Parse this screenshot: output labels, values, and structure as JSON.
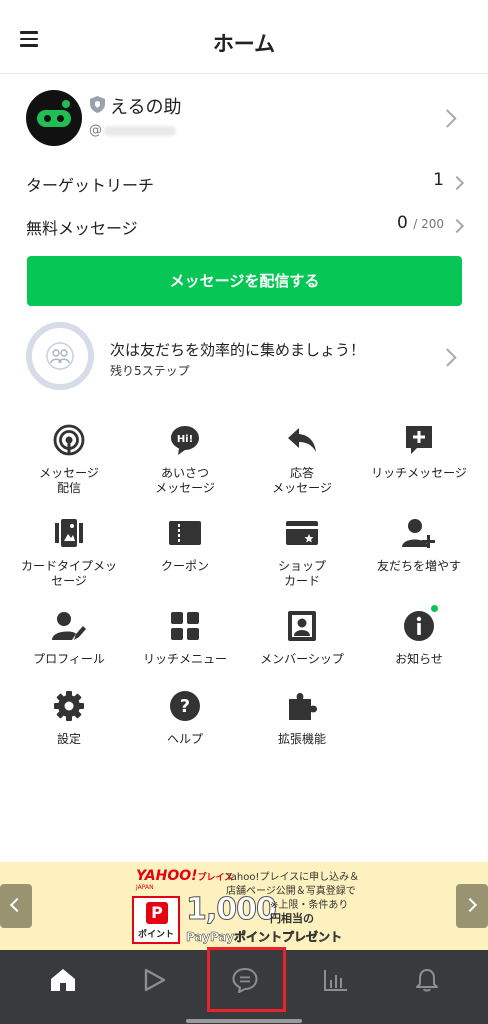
{
  "header": {
    "title": "ホーム",
    "menu_icon": "hamburger-icon"
  },
  "account": {
    "name": "えるの助",
    "id_prefix": "@",
    "badge_icon": "shield-icon"
  },
  "stats": {
    "target_reach_label": "ターゲットリーチ",
    "target_reach_value": "1",
    "free_messages_label": "無料メッセージ",
    "free_messages_value": "0",
    "free_messages_limit": "/ 200"
  },
  "cta": {
    "label": "メッセージを配信する",
    "color": "#06c755"
  },
  "steps": {
    "title": "次は友だちを効率的に集めましょう！",
    "subtitle": "残り5ステップ"
  },
  "menu": [
    {
      "label": "メッセージ\n配信",
      "icon": "broadcast-icon"
    },
    {
      "label": "あいさつ\nメッセージ",
      "icon": "greeting-icon"
    },
    {
      "label": "応答\nメッセージ",
      "icon": "reply-icon"
    },
    {
      "label": "リッチメッセージ",
      "icon": "rich-message-icon"
    },
    {
      "label": "カードタイプメッ\nセージ",
      "icon": "card-message-icon"
    },
    {
      "label": "クーポン",
      "icon": "coupon-icon"
    },
    {
      "label": "ショップ\nカード",
      "icon": "shop-card-icon"
    },
    {
      "label": "友だちを増やす",
      "icon": "add-friend-icon"
    },
    {
      "label": "プロフィール",
      "icon": "profile-icon"
    },
    {
      "label": "リッチメニュー",
      "icon": "rich-menu-icon"
    },
    {
      "label": "メンバーシップ",
      "icon": "membership-icon"
    },
    {
      "label": "お知らせ",
      "icon": "info-icon"
    },
    {
      "label": "設定",
      "icon": "gear-icon"
    },
    {
      "label": "ヘルプ",
      "icon": "help-icon"
    },
    {
      "label": "拡張機能",
      "icon": "puzzle-icon"
    }
  ],
  "banner": {
    "brand": "YAHOO!",
    "brand_place": "プレイス",
    "brand_sub": "JAPAN",
    "line1": "Yahoo!プレイスに申し込み＆",
    "line2": "店舗ページ公開＆写真登録で",
    "paypay_label": "ポイント",
    "amount": "1,000",
    "note": "※上限・条件あり",
    "amount_suffix": "円相当の",
    "bottom": "PayPayポイントプレゼント"
  },
  "tabbar": {
    "tabs": [
      "home-icon",
      "voom-icon",
      "chat-icon",
      "analytics-icon",
      "notification-icon"
    ],
    "selected_index": 0,
    "highlighted_index": 2
  }
}
